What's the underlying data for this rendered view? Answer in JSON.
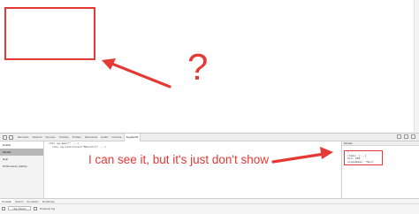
{
  "viewport": {
    "box_placeholder": "...",
    "question_mark": "?"
  },
  "devtools": {
    "tabs": [
      "Elements",
      "Network",
      "Sources",
      "Timeline",
      "Profiles",
      "Resources",
      "Audits",
      "Console",
      "AngularJS"
    ],
    "active_tab": "AngularJS",
    "sidebar": {
      "enable_label": "Enable",
      "items": [
        "Models",
        "Help",
        "Performance (Alpha)"
      ],
      "selected_item": "Models"
    },
    "main": {
      "lines": [
        "<div ng-app=\"\" ...>",
        "<div ng-controller=\"MainCtrl\" ...>"
      ]
    },
    "panel": {
      "header": "Models",
      "lines": [
        "{",
        "items: [...]",
        "$id: 002",
        "scopeName: 'Main'"
      ]
    },
    "bottom": {
      "tabs": [
        "Console",
        "Search",
        "Emulation",
        "Rendering"
      ],
      "active_tab": "Console",
      "frame_select": "<top frame>",
      "preserve_log": "Preserve log"
    }
  },
  "annotations": {
    "callout_text": "I can see it, but it's just don't show",
    "accent_color": "#e53935"
  }
}
